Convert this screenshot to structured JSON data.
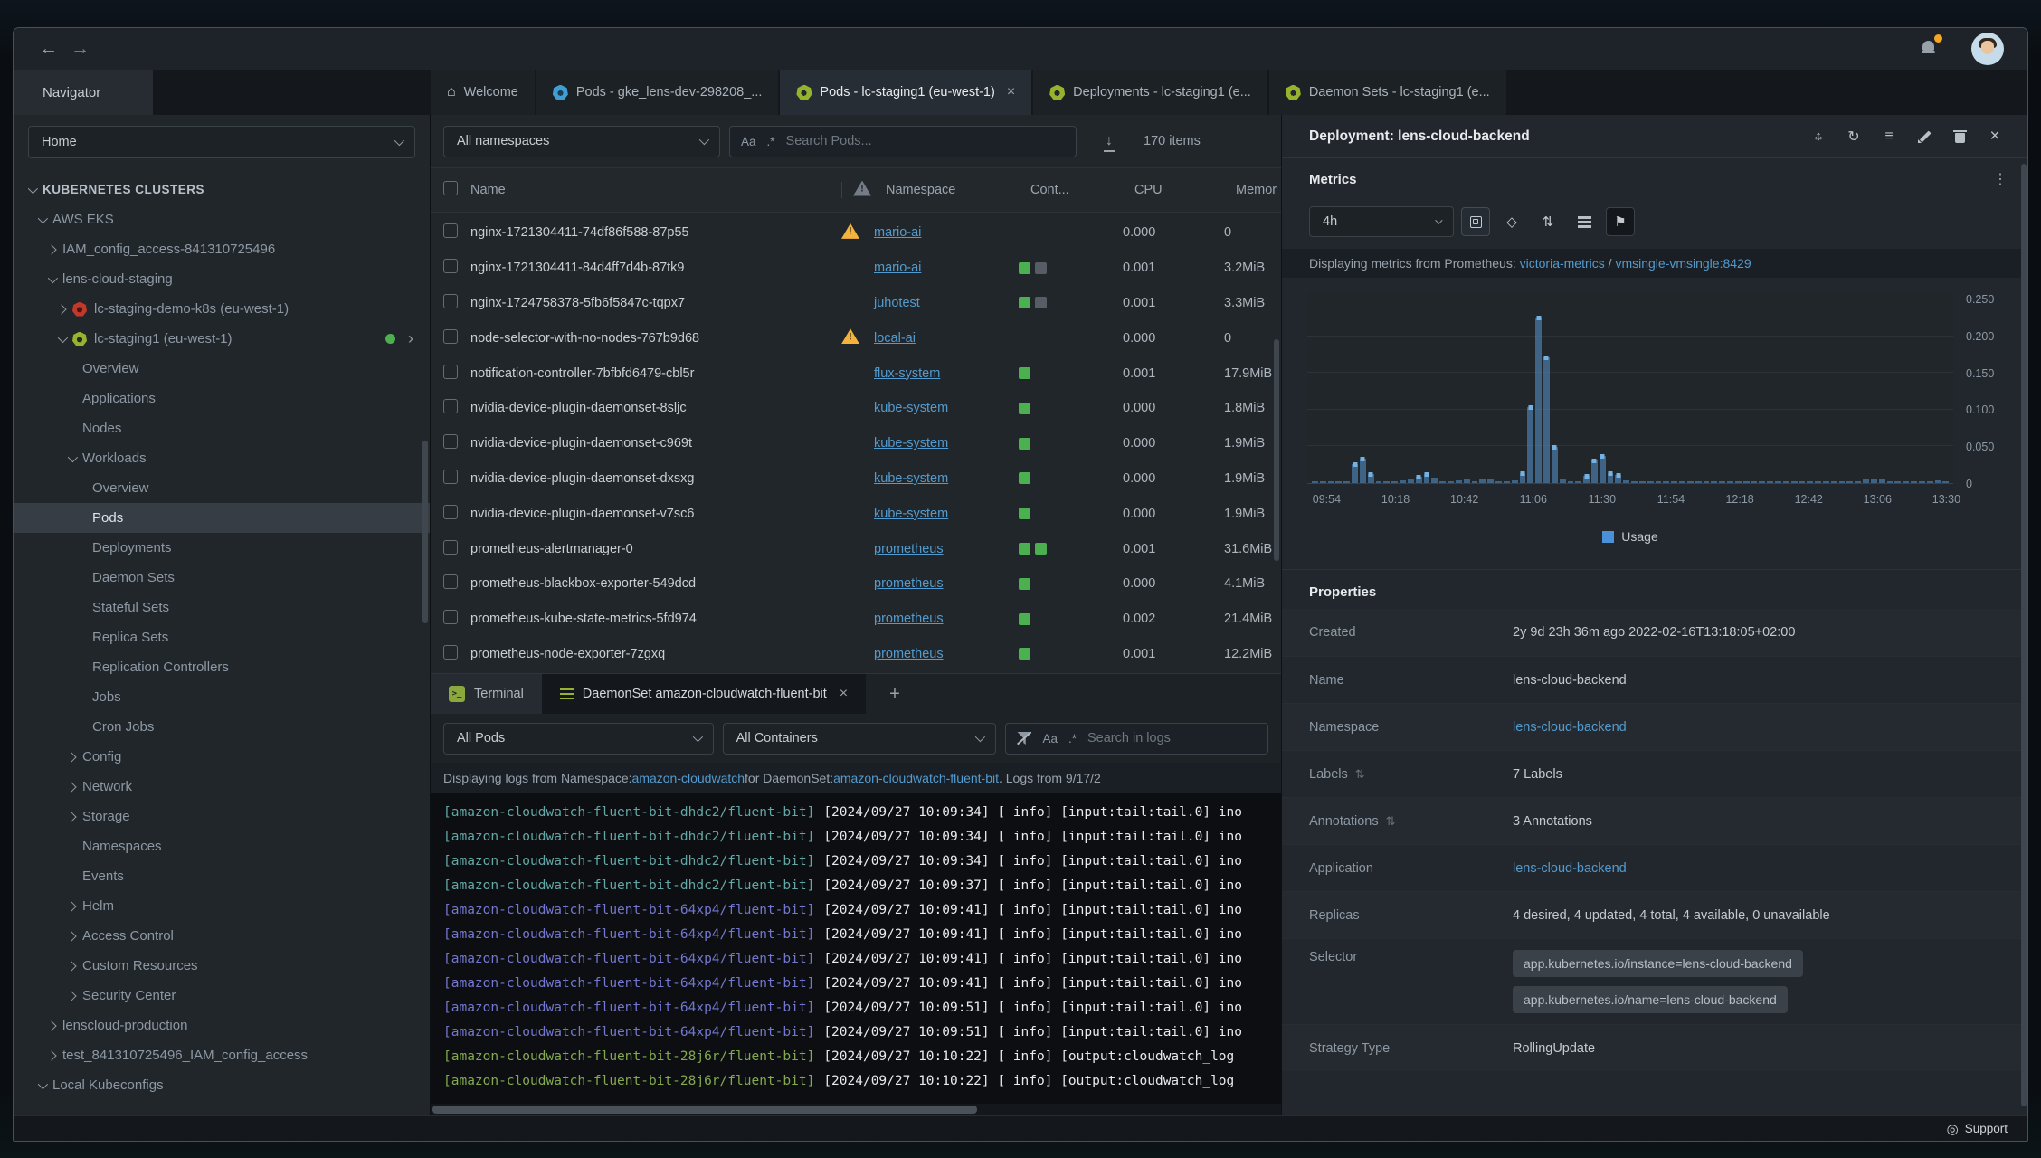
{
  "window": {
    "support_label": "Support"
  },
  "icons": {
    "back": "←",
    "forward": "→",
    "home": "⌂",
    "close": "×",
    "plus": "+",
    "download": "↓",
    "case": "Aa",
    "regex": ".*",
    "move_h": "↔",
    "move_v": "↕",
    "refresh": "↻",
    "menu": "≡",
    "kebab": "⋮",
    "sort": "⇅",
    "diamond": "◇",
    "flag": "⚑",
    "support": "◎",
    "chevron_right": "›",
    "terminal_prompt": ">_"
  },
  "colors": {
    "accent_link": "#539bce",
    "warning": "#f3b33c",
    "container_running": "#4caf50",
    "container_stopped": "#565d64",
    "bar": "#5a96cd",
    "marker": "#72b2e4",
    "status_dot": "#4caf50",
    "bell_badge": "#f5a623",
    "k8s_green": "#97b32d",
    "k8s_blue": "#3f9fd4",
    "k8s_red": "#c0392b"
  },
  "tabstrip": {
    "navigator_label": "Navigator",
    "tabs": [
      {
        "label": "Welcome",
        "icon": "home",
        "active": false,
        "closable": false
      },
      {
        "label": "Pods - gke_lens-dev-298208_...",
        "icon": "k8s-blue",
        "active": false,
        "closable": false
      },
      {
        "label": "Pods - lc-staging1 (eu-west-1)",
        "icon": "k8s-green",
        "active": true,
        "closable": true
      },
      {
        "label": "Deployments - lc-staging1 (e...",
        "icon": "k8s-green",
        "active": false,
        "closable": false
      },
      {
        "label": "Daemon Sets - lc-staging1 (e...",
        "icon": "k8s-green",
        "active": false,
        "closable": false
      }
    ]
  },
  "sidebar": {
    "context_selected": "Home",
    "tree": [
      {
        "label": "KUBERNETES CLUSTERS",
        "depth": 0,
        "arrow": "down",
        "style": "heading"
      },
      {
        "label": "AWS EKS",
        "depth": 1,
        "arrow": "down"
      },
      {
        "label": "IAM_config_access-841310725496",
        "depth": 2,
        "arrow": "right"
      },
      {
        "label": "lens-cloud-staging",
        "depth": 2,
        "arrow": "down"
      },
      {
        "label": "lc-staging-demo-k8s (eu-west-1)",
        "depth": 3,
        "arrow": "right",
        "icon": "red"
      },
      {
        "label": "lc-staging1 (eu-west-1)",
        "depth": 3,
        "arrow": "down",
        "icon": "green",
        "status_dot": true,
        "chevron": true
      },
      {
        "label": "Overview",
        "depth": 4
      },
      {
        "label": "Applications",
        "depth": 4
      },
      {
        "label": "Nodes",
        "depth": 4
      },
      {
        "label": "Workloads",
        "depth": 4,
        "arrow": "down"
      },
      {
        "label": "Overview",
        "depth": 5
      },
      {
        "label": "Pods",
        "depth": 5,
        "selected": true
      },
      {
        "label": "Deployments",
        "depth": 5
      },
      {
        "label": "Daemon Sets",
        "depth": 5
      },
      {
        "label": "Stateful Sets",
        "depth": 5
      },
      {
        "label": "Replica Sets",
        "depth": 5
      },
      {
        "label": "Replication Controllers",
        "depth": 5
      },
      {
        "label": "Jobs",
        "depth": 5
      },
      {
        "label": "Cron Jobs",
        "depth": 5
      },
      {
        "label": "Config",
        "depth": 4,
        "arrow": "right"
      },
      {
        "label": "Network",
        "depth": 4,
        "arrow": "right"
      },
      {
        "label": "Storage",
        "depth": 4,
        "arrow": "right"
      },
      {
        "label": "Namespaces",
        "depth": 4
      },
      {
        "label": "Events",
        "depth": 4
      },
      {
        "label": "Helm",
        "depth": 4,
        "arrow": "right"
      },
      {
        "label": "Access Control",
        "depth": 4,
        "arrow": "right"
      },
      {
        "label": "Custom Resources",
        "depth": 4,
        "arrow": "right"
      },
      {
        "label": "Security Center",
        "depth": 4,
        "arrow": "right"
      },
      {
        "label": "lenscloud-production",
        "depth": 2,
        "arrow": "right"
      },
      {
        "label": "test_841310725496_IAM_config_access",
        "depth": 2,
        "arrow": "right"
      },
      {
        "label": "Local Kubeconfigs",
        "depth": 1,
        "arrow": "down"
      }
    ]
  },
  "pods": {
    "namespace_filter": "All namespaces",
    "search_placeholder": "Search Pods...",
    "items_count": "170 items",
    "columns": {
      "name": "Name",
      "namespace": "Namespace",
      "containers": "Cont...",
      "cpu": "CPU",
      "memory": "Memor"
    },
    "rows": [
      {
        "name": "nginx-1721304411-74df86f588-87p55",
        "warning": true,
        "namespace": "mario-ai",
        "containers": [],
        "cpu": "0.000",
        "memory": "0"
      },
      {
        "name": "nginx-1721304411-84d4ff7d4b-87tk9",
        "warning": false,
        "namespace": "mario-ai",
        "containers": [
          "running",
          "stopped"
        ],
        "cpu": "0.001",
        "memory": "3.2MiB"
      },
      {
        "name": "nginx-1724758378-5fb6f5847c-tqpx7",
        "warning": false,
        "namespace": "juhotest",
        "containers": [
          "running",
          "stopped"
        ],
        "cpu": "0.001",
        "memory": "3.3MiB"
      },
      {
        "name": "node-selector-with-no-nodes-767b9d68",
        "warning": true,
        "namespace": "local-ai",
        "containers": [],
        "cpu": "0.000",
        "memory": "0"
      },
      {
        "name": "notification-controller-7bfbfd6479-cbl5r",
        "warning": false,
        "namespace": "flux-system",
        "containers": [
          "running"
        ],
        "cpu": "0.001",
        "memory": "17.9MiB"
      },
      {
        "name": "nvidia-device-plugin-daemonset-8sljc",
        "warning": false,
        "namespace": "kube-system",
        "containers": [
          "running"
        ],
        "cpu": "0.000",
        "memory": "1.8MiB"
      },
      {
        "name": "nvidia-device-plugin-daemonset-c969t",
        "warning": false,
        "namespace": "kube-system",
        "containers": [
          "running"
        ],
        "cpu": "0.000",
        "memory": "1.9MiB"
      },
      {
        "name": "nvidia-device-plugin-daemonset-dxsxg",
        "warning": false,
        "namespace": "kube-system",
        "containers": [
          "running"
        ],
        "cpu": "0.000",
        "memory": "1.9MiB"
      },
      {
        "name": "nvidia-device-plugin-daemonset-v7sc6",
        "warning": false,
        "namespace": "kube-system",
        "containers": [
          "running"
        ],
        "cpu": "0.000",
        "memory": "1.9MiB"
      },
      {
        "name": "prometheus-alertmanager-0",
        "warning": false,
        "namespace": "prometheus",
        "containers": [
          "running",
          "running"
        ],
        "cpu": "0.001",
        "memory": "31.6MiB"
      },
      {
        "name": "prometheus-blackbox-exporter-549dcd",
        "warning": false,
        "namespace": "prometheus",
        "containers": [
          "running"
        ],
        "cpu": "0.000",
        "memory": "4.1MiB"
      },
      {
        "name": "prometheus-kube-state-metrics-5fd974",
        "warning": false,
        "namespace": "prometheus",
        "containers": [
          "running"
        ],
        "cpu": "0.002",
        "memory": "21.4MiB"
      },
      {
        "name": "prometheus-node-exporter-7zgxq",
        "warning": false,
        "namespace": "prometheus",
        "containers": [
          "running"
        ],
        "cpu": "0.001",
        "memory": "12.2MiB"
      }
    ]
  },
  "dock": {
    "tabs": [
      {
        "label": "Terminal",
        "icon": "terminal",
        "active": false,
        "closable": false
      },
      {
        "label": "DaemonSet amazon-cloudwatch-fluent-bit",
        "icon": "logs",
        "active": true,
        "closable": true
      }
    ],
    "pod_filter": "All Pods",
    "container_filter": "All Containers",
    "search_placeholder": "Search in logs",
    "info": {
      "prefix": "Displaying logs from Namespace: ",
      "namespace_link": "amazon-cloudwatch",
      "middle": " for DaemonSet: ",
      "daemonset_link": "amazon-cloudwatch-fluent-bit",
      "suffix": ". Logs from 9/17/2"
    },
    "log_lines": [
      {
        "source": "[amazon-cloudwatch-fluent-bit-dhdc2/fluent-bit]",
        "color": "teal",
        "message": "[2024/09/27 10:09:34] [ info] [input:tail:tail.0] ino"
      },
      {
        "source": "[amazon-cloudwatch-fluent-bit-dhdc2/fluent-bit]",
        "color": "teal",
        "message": "[2024/09/27 10:09:34] [ info] [input:tail:tail.0] ino"
      },
      {
        "source": "[amazon-cloudwatch-fluent-bit-dhdc2/fluent-bit]",
        "color": "teal",
        "message": "[2024/09/27 10:09:34] [ info] [input:tail:tail.0] ino"
      },
      {
        "source": "[amazon-cloudwatch-fluent-bit-dhdc2/fluent-bit]",
        "color": "teal",
        "message": "[2024/09/27 10:09:37] [ info] [input:tail:tail.0] ino"
      },
      {
        "source": "[amazon-cloudwatch-fluent-bit-64xp4/fluent-bit]",
        "color": "purple",
        "message": "[2024/09/27 10:09:41] [ info] [input:tail:tail.0] ino"
      },
      {
        "source": "[amazon-cloudwatch-fluent-bit-64xp4/fluent-bit]",
        "color": "purple",
        "message": "[2024/09/27 10:09:41] [ info] [input:tail:tail.0] ino"
      },
      {
        "source": "[amazon-cloudwatch-fluent-bit-64xp4/fluent-bit]",
        "color": "purple",
        "message": "[2024/09/27 10:09:41] [ info] [input:tail:tail.0] ino"
      },
      {
        "source": "[amazon-cloudwatch-fluent-bit-64xp4/fluent-bit]",
        "color": "purple",
        "message": "[2024/09/27 10:09:41] [ info] [input:tail:tail.0] ino"
      },
      {
        "source": "[amazon-cloudwatch-fluent-bit-64xp4/fluent-bit]",
        "color": "purple",
        "message": "[2024/09/27 10:09:51] [ info] [input:tail:tail.0] ino"
      },
      {
        "source": "[amazon-cloudwatch-fluent-bit-64xp4/fluent-bit]",
        "color": "purple",
        "message": "[2024/09/27 10:09:51] [ info] [input:tail:tail.0] ino"
      },
      {
        "source": "[amazon-cloudwatch-fluent-bit-28j6r/fluent-bit]",
        "color": "green",
        "message": "[2024/09/27 10:10:22] [ info] [output:cloudwatch_log"
      },
      {
        "source": "[amazon-cloudwatch-fluent-bit-28j6r/fluent-bit]",
        "color": "green",
        "message": "[2024/09/27 10:10:22] [ info] [output:cloudwatch_log"
      }
    ]
  },
  "detail": {
    "title": "Deployment: lens-cloud-backend",
    "metrics": {
      "title": "Metrics",
      "range": "4h",
      "source": {
        "prefix": "Displaying metrics from Prometheus: ",
        "link1": "victoria-metrics",
        "sep": " / ",
        "link2": "vmsingle-vmsingle:8429"
      }
    },
    "properties": {
      "title": "Properties",
      "rows": [
        {
          "label": "Created",
          "type": "text",
          "value": "2y 9d 23h 36m ago 2022-02-16T13:18:05+02:00"
        },
        {
          "label": "Name",
          "type": "text",
          "value": "lens-cloud-backend"
        },
        {
          "label": "Namespace",
          "type": "link",
          "value": "lens-cloud-backend"
        },
        {
          "label": "Labels",
          "type": "text",
          "value": "7 Labels",
          "sortable": true
        },
        {
          "label": "Annotations",
          "type": "text",
          "value": "3 Annotations",
          "sortable": true
        },
        {
          "label": "Application",
          "type": "link",
          "value": "lens-cloud-backend"
        },
        {
          "label": "Replicas",
          "type": "text",
          "value": "4 desired, 4 updated, 4 total, 4 available, 0 unavailable"
        },
        {
          "label": "Selector",
          "type": "badges",
          "values": [
            "app.kubernetes.io/instance=lens-cloud-backend",
            "app.kubernetes.io/name=lens-cloud-backend"
          ]
        },
        {
          "label": "Strategy Type",
          "type": "text",
          "value": "RollingUpdate"
        }
      ]
    }
  },
  "chart_data": {
    "type": "bar",
    "legend": "Usage",
    "legend_position": "bottom",
    "ylim": [
      0,
      0.26
    ],
    "bar_color": "#5a96cd",
    "marker_color": "#72b2e4",
    "x_ticks": [
      "09:54",
      "10:18",
      "10:42",
      "11:06",
      "11:30",
      "11:54",
      "12:18",
      "12:42",
      "13:06",
      "13:30"
    ],
    "y_ticks": [
      {
        "v": 0.25,
        "label": "0.250"
      },
      {
        "v": 0.2,
        "label": "0.200"
      },
      {
        "v": 0.15,
        "label": "0.150"
      },
      {
        "v": 0.1,
        "label": "0.100"
      },
      {
        "v": 0.05,
        "label": "0.050"
      },
      {
        "v": 0,
        "label": "0"
      }
    ],
    "series": [
      {
        "name": "Usage",
        "values": [
          0.002,
          0.002,
          0.001,
          0.002,
          0.003,
          0.026,
          0.033,
          0.012,
          0.003,
          0.002,
          0.003,
          0.004,
          0.005,
          0.009,
          0.012,
          0.007,
          0.003,
          0.002,
          0.004,
          0.005,
          0.003,
          0.006,
          0.005,
          0.003,
          0.002,
          0.004,
          0.013,
          0.104,
          0.226,
          0.171,
          0.049,
          0.005,
          0.002,
          0.003,
          0.01,
          0.031,
          0.037,
          0.014,
          0.011,
          0.004,
          0.002,
          0.002,
          0.001,
          0.002,
          0.001,
          0.002,
          0.001,
          0.001,
          0.002,
          0.002,
          0.003,
          0.002,
          0.001,
          0.003,
          0.002,
          0.001,
          0.002,
          0.003,
          0.002,
          0.001,
          0.001,
          0.002,
          0.003,
          0.002,
          0.001,
          0.002,
          0.001,
          0.002,
          0.003,
          0.005,
          0.006,
          0.005,
          0.002,
          0.001,
          0.002,
          0.001,
          0.002,
          0.003,
          0.004,
          0.003
        ]
      }
    ]
  }
}
